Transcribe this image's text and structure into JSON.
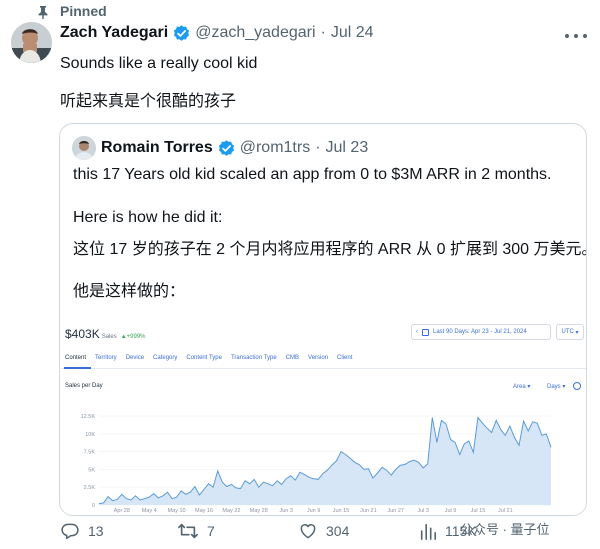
{
  "pinned_label": "Pinned",
  "tweet": {
    "name": "Zach Yadegari",
    "handle": "@zach_yadegari",
    "separator": "·",
    "date": "Jul 24",
    "text_lines": [
      "Sounds like a really cool kid",
      "听起来真是个很酷的孩子"
    ]
  },
  "quote": {
    "name": "Romain Torres",
    "handle": "@rom1trs",
    "separator": "·",
    "date": "Jul 23",
    "text_lines": [
      "this 17 Years old kid scaled an app from 0 to $3M ARR in 2 months.",
      "Here is how he did it:",
      "这位 17 岁的孩子在 2 个月内将应用程序的 ARR 从 0 扩展到 300 万美元。",
      "他是这样做的："
    ]
  },
  "dashboard": {
    "total_value": "$403K",
    "total_label": "Sales",
    "growth": "▲+999%",
    "date_range": "Last 90 Days: Apr 23 - Jul 21, 2024",
    "timezone": "UTC",
    "tabs": [
      "Content",
      "Territory",
      "Device",
      "Category",
      "Content Type",
      "Transaction Type",
      "CMB",
      "Version",
      "Client"
    ],
    "metric_label": "Sales per Day",
    "chart_type_select": "Area",
    "granularity_select": "Days"
  },
  "chart_data": {
    "type": "area",
    "title": "",
    "xlabel": "",
    "ylabel": "",
    "y_ticks": [
      "0",
      "2.5K",
      "5K",
      "7.5K",
      "10K",
      "12.5K"
    ],
    "ylim": [
      0,
      13500
    ],
    "x_ticks": [
      "Apr 28",
      "May 4",
      "May 10",
      "May 16",
      "May 22",
      "May 28",
      "Jun 3",
      "Jun 9",
      "Jun 15",
      "Jun 21",
      "Jun 27",
      "Jul 3",
      "Jul 9",
      "Jul 15",
      "Jul 21"
    ],
    "x_start_day_offset": 5,
    "series": [
      {
        "name": "",
        "color": "#5b9bd5",
        "values": [
          200,
          300,
          1200,
          600,
          800,
          1500,
          900,
          700,
          1300,
          700,
          900,
          1100,
          1600,
          1000,
          1300,
          1800,
          900,
          1100,
          2000,
          1500,
          1800,
          2600,
          1400,
          2200,
          3000,
          2500,
          4800,
          3200,
          2600,
          2900,
          2400,
          2300,
          3400,
          3000,
          3600,
          2500,
          3200,
          3000,
          2700,
          3400,
          2900,
          3700,
          4100,
          3500,
          4600,
          4300,
          3900,
          3700,
          3600,
          4400,
          4900,
          5600,
          6200,
          7500,
          7100,
          6600,
          6000,
          5700,
          5000,
          5100,
          3800,
          4500,
          5300,
          4900,
          4200,
          5000,
          5600,
          5700,
          6100,
          6300,
          6000,
          5200,
          5800,
          12300,
          8800,
          11900,
          11400,
          9200,
          8800,
          7100,
          8600,
          9000,
          7400,
          12300,
          11500,
          10800,
          10200,
          11900,
          10600,
          9800,
          11100,
          9500,
          8400,
          11800,
          10400,
          11700,
          11500,
          9800,
          10000,
          8100
        ]
      }
    ],
    "grid": true,
    "legend": "none"
  },
  "actions": {
    "replies": "13",
    "reposts": "7",
    "likes": "304",
    "views": "115K"
  },
  "watermark": "公众号 · 量子位",
  "colors": {
    "verified": "#1d9bf0",
    "muted": "#536471",
    "border": "#cfd9de",
    "dash_accent": "#3b6fd8"
  }
}
